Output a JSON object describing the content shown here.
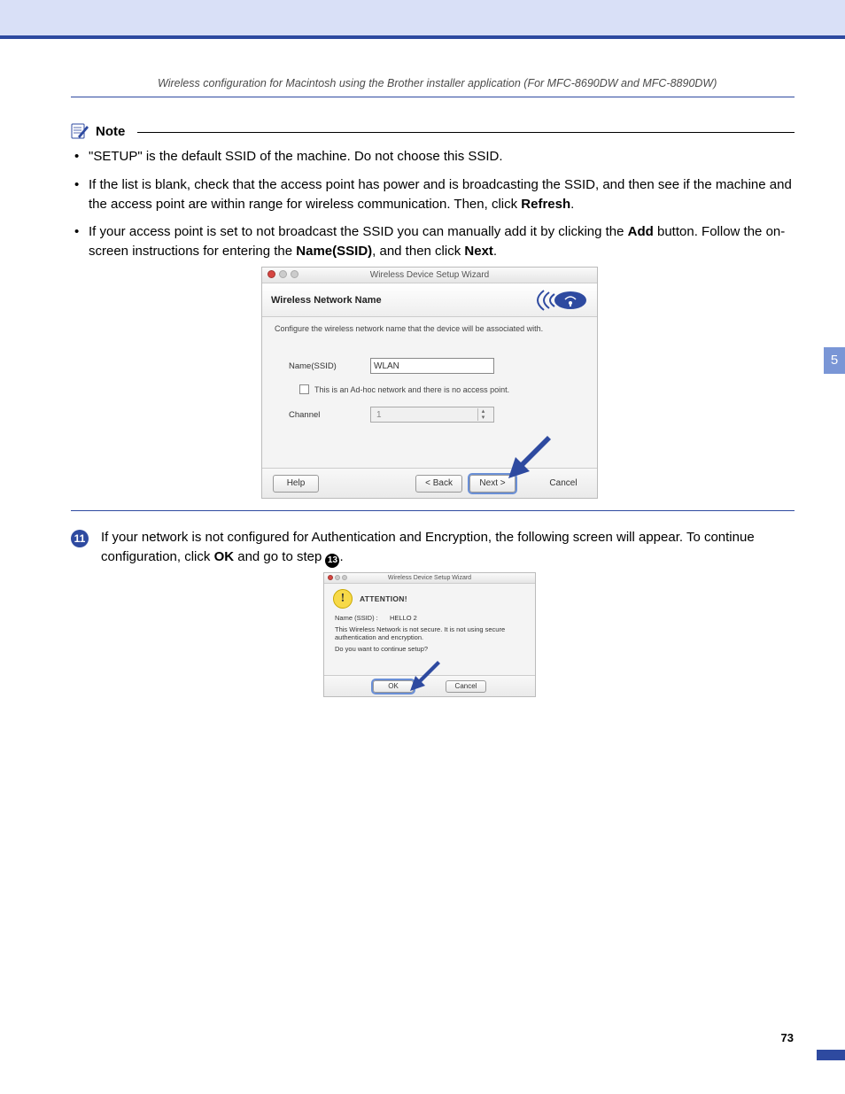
{
  "header": "Wireless configuration for Macintosh using the Brother installer application (For MFC-8690DW and MFC-8890DW)",
  "side_tab": "5",
  "page_number": "73",
  "note": {
    "label": "Note",
    "bullet1a": "\"SETUP\" is the default SSID of the machine. Do not choose this SSID.",
    "bullet2a": "If the list is blank, check that the access point has power and is broadcasting the SSID, and then see if the machine and the access point are within range for wireless communication. Then, click ",
    "bullet2b": "Refresh",
    "bullet2c": ".",
    "bullet3a": "If your access point is set to not broadcast the SSID you can manually add it by clicking the ",
    "bullet3b": "Add",
    "bullet3c": " button. Follow the on-screen instructions for entering the ",
    "bullet3d": "Name(SSID)",
    "bullet3e": ", and then click ",
    "bullet3f": "Next",
    "bullet3g": "."
  },
  "dialog1": {
    "title": "Wireless Device Setup Wizard",
    "heading": "Wireless Network Name",
    "config_text": "Configure the wireless network name that the device will be associated with.",
    "ssid_label": "Name(SSID)",
    "ssid_value": "WLAN",
    "adhoc_label": "This is an Ad-hoc network and there is no access point.",
    "channel_label": "Channel",
    "channel_value": "1",
    "help": "Help",
    "back": "< Back",
    "next": "Next >",
    "cancel": "Cancel"
  },
  "step11": {
    "num": "11",
    "text_a": "If your network is not configured for Authentication and Encryption, the following screen will appear. To continue configuration, click ",
    "text_b": "OK",
    "text_c": " and go to step ",
    "ref": "13",
    "text_d": "."
  },
  "dialog2": {
    "title": "Wireless Device Setup Wizard",
    "attention": "ATTENTION!",
    "ssid_label": "Name (SSID) :",
    "ssid_value": "HELLO 2",
    "warn": "This Wireless Network is not secure. It is not using secure authentication and encryption.",
    "question": "Do you want to continue setup?",
    "ok": "OK",
    "cancel": "Cancel"
  }
}
